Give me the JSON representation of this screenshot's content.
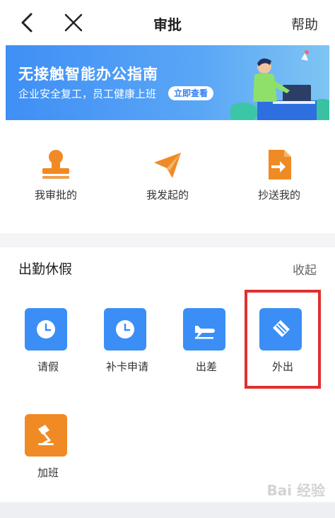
{
  "nav": {
    "title": "审批",
    "help": "帮助"
  },
  "banner": {
    "title": "无接触智能办公指南",
    "subtitle": "企业安全复工，员工健康上班",
    "button": "立即查看"
  },
  "quick_links": [
    {
      "label": "我审批的",
      "icon": "stamp-icon"
    },
    {
      "label": "我发起的",
      "icon": "paper-plane-icon"
    },
    {
      "label": "抄送我的",
      "icon": "document-forward-icon"
    }
  ],
  "attendance": {
    "title": "出勤休假",
    "collapse": "收起",
    "items": [
      {
        "label": "请假",
        "icon": "clock-icon"
      },
      {
        "label": "补卡申请",
        "icon": "clock-icon"
      },
      {
        "label": "出差",
        "icon": "airplane-icon"
      },
      {
        "label": "外出",
        "icon": "eraser-icon"
      },
      {
        "label": "加班",
        "icon": "desk-lamp-icon"
      }
    ]
  },
  "watermark": "Bai 经验",
  "colors": {
    "primary": "#3a8ef6",
    "orange": "#f08a24",
    "highlight": "#e0302e"
  }
}
